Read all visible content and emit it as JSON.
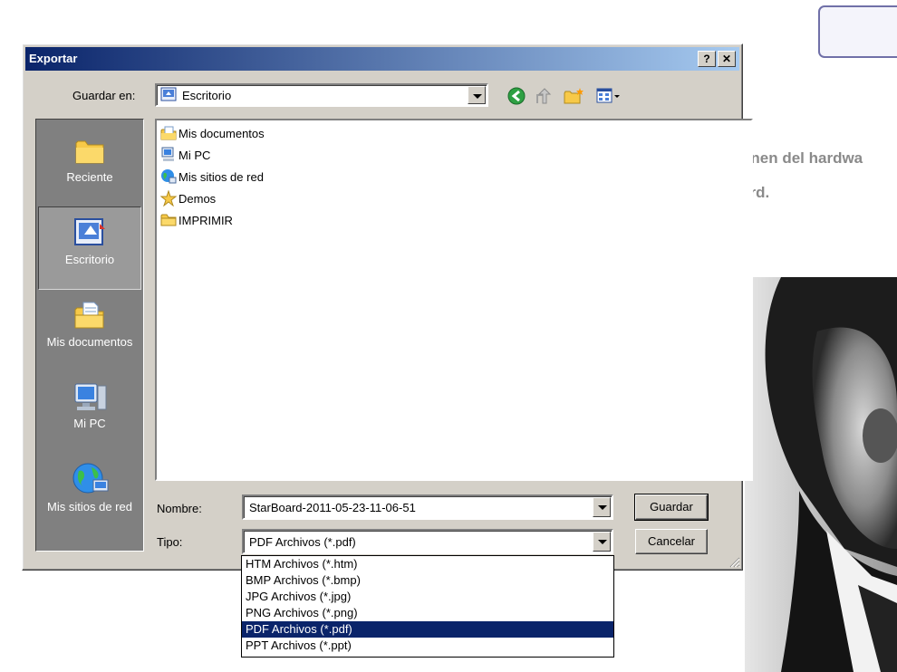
{
  "dialog": {
    "title": "Exportar",
    "help_label": "?",
    "close_label": "✕",
    "save_in_label": "Guardar en:",
    "location": "Escritorio",
    "name_label": "Nombre:",
    "file_name": "StarBoard-2011-05-23-11-06-51",
    "type_label": "Tipo:",
    "file_type": "PDF Archivos (*.pdf)",
    "save_button": "Guardar",
    "cancel_button": "Cancelar"
  },
  "toolbar": {
    "icons": [
      "back-icon",
      "up-folder-icon",
      "new-folder-icon",
      "view-menu-icon"
    ]
  },
  "places": [
    {
      "label": "Reciente",
      "icon": "recent-folder-icon",
      "active": false
    },
    {
      "label": "Escritorio",
      "icon": "desktop-icon",
      "active": true
    },
    {
      "label": "Mis documentos",
      "icon": "my-documents-icon",
      "active": false
    },
    {
      "label": "Mi PC",
      "icon": "my-computer-icon",
      "active": false
    },
    {
      "label": "Mis sitios de red",
      "icon": "network-places-icon",
      "active": false
    }
  ],
  "files": [
    {
      "name": "Mis documentos",
      "icon": "documents-icon"
    },
    {
      "name": "Mi PC",
      "icon": "computer-icon"
    },
    {
      "name": "Mis sitios de red",
      "icon": "network-icon"
    },
    {
      "name": "Demos",
      "icon": "star-folder-icon"
    },
    {
      "name": "IMPRIMIR",
      "icon": "folder-icon"
    }
  ],
  "file_types": [
    "HTM Archivos (*.htm)",
    "BMP Archivos (*.bmp)",
    "JPG Archivos (*.jpg)",
    "PNG Archivos (*.png)",
    "PDF Archivos (*.pdf)",
    "PPT Archivos (*.ppt)"
  ],
  "selected_type_index": 4,
  "background": {
    "line1": "onen del hardwa",
    "line2": "ard."
  }
}
